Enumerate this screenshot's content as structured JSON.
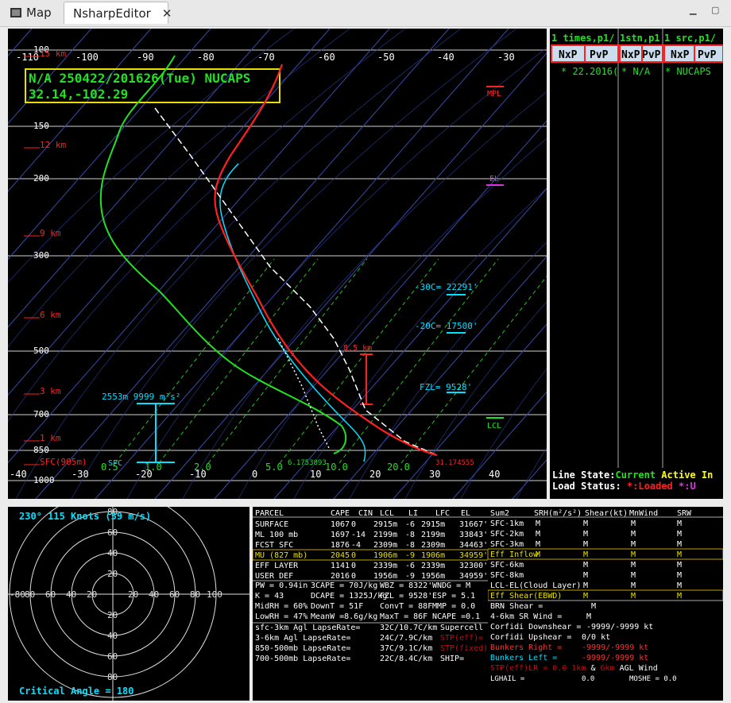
{
  "tabs": [
    {
      "label": "Map",
      "active": false
    },
    {
      "label": "NsharpEditor",
      "active": true
    }
  ],
  "skewt": {
    "title_line1": "N/A 250422/201626(Tue) NUCAPS",
    "title_line2": "32.14,-102.29",
    "top_temps": [
      "-110",
      "-100",
      "-90",
      "-80",
      "-70",
      "-60",
      "-50",
      "-40",
      "-30"
    ],
    "bottom_temps": [
      "-40",
      "-30",
      "-20",
      "-10",
      "0",
      "10",
      "20",
      "30",
      "40"
    ],
    "pressures": [
      "100",
      "150",
      "200",
      "300",
      "500",
      "700",
      "850",
      "1000"
    ],
    "heights": [
      "15 km",
      "12 km",
      "9 km",
      "6 km",
      "3 km",
      "1 km",
      "SFC(905m)"
    ],
    "mixing_ratios": [
      "0.5",
      "1.0",
      "2.0",
      "5.0",
      "10.0",
      "20.0"
    ],
    "mpl": "MPL",
    "el": "EL",
    "lcl": "LCL",
    "m30c": "-30C= 22291'",
    "m20c": "-20C= 17500'",
    "fzl": "FZL= 9528'",
    "srh_label": "2553m 9999 m²s²",
    "sfc": "SFC",
    "dew_sfc": "6.1753893",
    "temp_sfc": "31.174555",
    "level_label": "8.5 km"
  },
  "list": {
    "headers": [
      "1 times,p1/",
      "1stn,p1",
      "1 src,p1/"
    ],
    "buttons": [
      "NxP",
      "PvP",
      "NxP",
      "PvP",
      "NxP",
      "PvP"
    ],
    "rows": [
      "* 22.2016(",
      "* N/A",
      "* NUCAPS"
    ],
    "line_state_label": "Line State:",
    "line_state_current": "Current",
    "line_state_active": "Active In",
    "load_status_label": "Load Status:",
    "load_status_star": "*",
    ":loaded": ":Loaded",
    "load_status_star2": "*",
    ":u": ":U"
  },
  "hodo": {
    "title": "230°  115 Knots (59 m/s)",
    "critical": "Critical Angle = 180",
    "ring_labels": [
      "20",
      "40",
      "60",
      "80",
      "100"
    ]
  },
  "parcel": {
    "headers": [
      "PARCEL",
      "CAPE",
      "CIN",
      "LCL",
      "LI",
      "LFC",
      "EL"
    ],
    "rows": [
      [
        "SURFACE",
        "1067",
        "0",
        "2915m",
        "-6",
        "2915m",
        "31667'"
      ],
      [
        "ML 100 mb",
        "1697",
        "-14",
        "2199m",
        "-8",
        "2199m",
        "33843'"
      ],
      [
        "FCST SFC",
        "1876",
        "-4",
        "2309m",
        "-8",
        "2309m",
        "34463'"
      ],
      [
        "MU (827 mb)",
        "2045",
        "0",
        "1906m",
        "-9",
        "1906m",
        "34959'"
      ],
      [
        "EFF LAYER",
        "1141",
        "0",
        "2339m",
        "-6",
        "2339m",
        "32300'"
      ],
      [
        "USER DEF",
        "2016",
        "0",
        "1956m",
        "-9",
        "1956m",
        "34959'"
      ]
    ],
    "misc": [
      "PW = 0.94in",
      "3CAPE = 70J/kg",
      "WBZ = 8322'",
      "WNDG = M",
      "K = 43",
      "DCAPE = 1325J/kg",
      "FZL = 9528'",
      "ESP = 5.1",
      "MidRH = 60%",
      "DownT = 51F",
      "ConvT = 88F",
      "MMP = 0.0",
      "LowRH = 47%",
      "MeanW =8.6g/kg",
      "MaxT = 86F",
      "NCAPE =0.1"
    ],
    "lapse": [
      [
        "sfc-3km Agl LapseRate=",
        "32C/10.7C/km"
      ],
      [
        "3-6km Agl LapseRate=",
        "24C/7.9C/km"
      ],
      [
        "850-500mb LapseRate=",
        "37C/9.1C/km"
      ],
      [
        "700-500mb LapseRate=",
        "22C/8.4C/km"
      ]
    ],
    "side": [
      "Supercell",
      "STP(eff)=",
      "STP(fixed)",
      "SHIP="
    ]
  },
  "summ": {
    "headers": [
      "Sum2",
      "SRH(m²/s²)",
      "Shear(kt)",
      "MnWind",
      "SRW"
    ],
    "rows": [
      [
        "SFC-1km",
        "M",
        "M",
        "M",
        "M"
      ],
      [
        "SFC-2km",
        "M",
        "M",
        "M",
        "M"
      ],
      [
        "SFC-3km",
        "M",
        "M",
        "M",
        "M"
      ],
      [
        "Eff Inflow",
        "M",
        "M",
        "M",
        "M"
      ],
      [
        "SFC-6km",
        "",
        "M",
        "M",
        "M"
      ],
      [
        "SFC-8km",
        "",
        "M",
        "M",
        "M"
      ],
      [
        "LCL-EL(Cloud Layer)",
        "",
        "M",
        "M",
        "M"
      ],
      [
        "Eff Shear(EBWD)",
        "",
        "M",
        "M",
        "M"
      ]
    ],
    "brn": "BRN Shear =",
    "brn_val": "M",
    "srwind": "4-6km SR Wind =",
    "srwind_val": "M",
    "cdown": "Corfidi Downshear =",
    "cdown_val": "-9999/-9999 kt",
    "cup": "Corfidi Upshear =",
    "cup_val": "0/0 kt",
    "bright": "Bunkers Right =",
    "bright_val": "-9999/-9999 kt",
    "bleft": "Bunkers Left =",
    "bleft_val": "-9999/-9999 kt",
    "stplr": "STP(eff)LR =",
    "stplr_val": "0.0",
    "stplr_1km": "1km",
    "stplr_amp": "&",
    "stplr_6km": "6km",
    "stplr_agl": "AGL Wind",
    "lghail": "LGHAIL =",
    "lghail_val": "0.0",
    "moshe": "MOSHE = 0.0"
  },
  "colors": {
    "temp": "#ff2020",
    "dew": "#22e022",
    "wetbulb": "#00e0ff",
    "parcel": "#ffffff",
    "title_box": "#e8e000",
    "green": "#22e022",
    "cyan": "#00e0ff",
    "red": "#ff2020",
    "yellow": "#ffff00",
    "magenta": "#dd33dd"
  }
}
